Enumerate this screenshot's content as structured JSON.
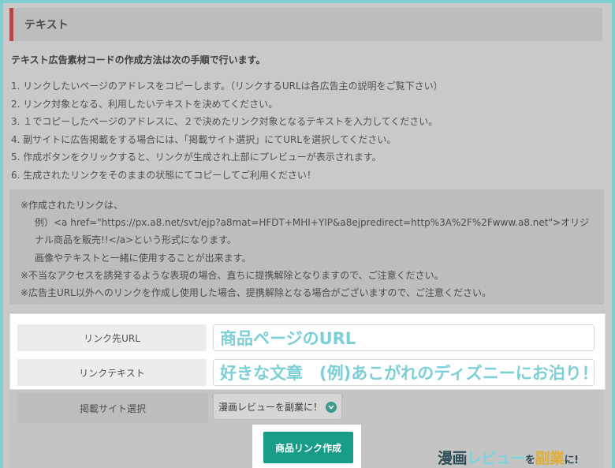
{
  "section": {
    "title": "テキスト"
  },
  "lead": "テキスト広告素材コードの作成方法は次の手順で行います。",
  "steps": [
    "1. リンクしたいページのアドレスをコピーします。（リンクするURLは各広告主の説明をご覧下さい）",
    "2. リンク対象となる、利用したいテキストを決めてください。",
    "3. １でコピーしたページのアドレスに、２で決めたリンク対象となるテキストを入力してください。",
    "4. 副サイトに広告掲載をする場合には、「掲載サイト選択」にてURLを選択してください。",
    "5. 作成ボタンをクリックすると、リンクが生成され上部にプレビューが表示されます。",
    "6. 生成されたリンクをそのままの状態にてコピーしてご利用ください！"
  ],
  "notes": {
    "line1": "※作成されたリンクは、",
    "line2": "例）<a href=\"https://px.a8.net/svt/ejp?a8mat=HFDT+MHI+YIP&a8ejpredirect=http%3A%2F%2Fwww.a8.net\">オリジ",
    "line3": "ナル商品を販売!!</a>という形式になります。",
    "line4": "画像やテキストと一緒に使用することが出来ます。",
    "line5": "※不当なアクセスを誘発するような表現の場合、直ちに提携解除となりますので、ご注意ください。",
    "line6": "※広告主URL以外へのリンクを作成し使用した場合、提携解除となる場合がございますので、ご注意ください。"
  },
  "form": {
    "url_label": "リンク先URL",
    "url_value": "商品ページのURL",
    "text_label": "リンクテキスト",
    "text_value": "好きな文章　(例)あこがれのディズニーにお泊り！",
    "site_label": "掲載サイト選択",
    "site_selected": "漫画レビューを副業に！",
    "submit_label": "商品リンク作成"
  },
  "watermark": {
    "part1": "漫画",
    "part2": "レビュー",
    "part3": "を",
    "part4": "副業",
    "part5": "に!"
  },
  "colors": {
    "frame_border": "#7fcfd0",
    "accent_bar": "#b24848",
    "button": "#169c87",
    "input_text": "#7ccfd6"
  }
}
